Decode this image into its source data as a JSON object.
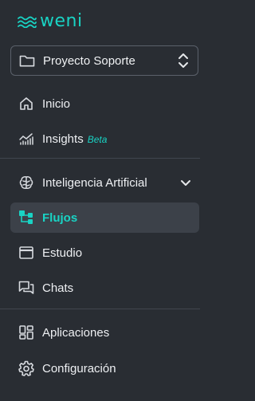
{
  "brand": {
    "name": "weni",
    "color": "#19d3c4"
  },
  "project": {
    "name": "Proyecto Soporte",
    "icon": "folder-icon",
    "toggle_icon": "chevron-up-down-icon"
  },
  "nav": {
    "inicio": {
      "label": "Inicio",
      "icon": "home-icon"
    },
    "insights": {
      "label": "Insights",
      "badge": "Beta",
      "icon": "chart-icon"
    },
    "ia": {
      "label": "Inteligencia Artificial",
      "icon": "brain-icon",
      "expand_icon": "chevron-down-icon"
    },
    "flujos": {
      "label": "Flujos",
      "icon": "flow-icon",
      "active": true
    },
    "estudio": {
      "label": "Estudio",
      "icon": "window-icon"
    },
    "chats": {
      "label": "Chats",
      "icon": "chat-icon"
    },
    "aplicaciones": {
      "label": "Aplicaciones",
      "icon": "apps-icon"
    },
    "configuracion": {
      "label": "Configuración",
      "icon": "gear-icon"
    }
  },
  "colors": {
    "background": "#292d33",
    "active_bg": "#3c4149",
    "accent": "#19d3c4",
    "text": "#eef0f3"
  }
}
